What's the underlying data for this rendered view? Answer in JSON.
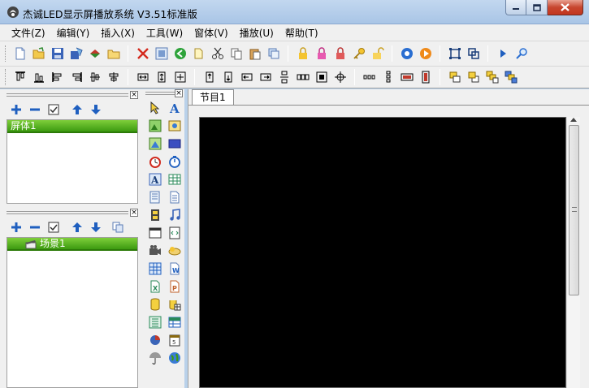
{
  "window": {
    "title": "杰诚LED显示屏播放系统 V3.51标准版"
  },
  "menu": [
    {
      "name": "menu-file",
      "label": "文件(Z)"
    },
    {
      "name": "menu-edit",
      "label": "编辑(Y)"
    },
    {
      "name": "menu-insert",
      "label": "插入(X)"
    },
    {
      "name": "menu-tools",
      "label": "工具(W)"
    },
    {
      "name": "menu-window",
      "label": "窗体(V)"
    },
    {
      "name": "menu-play",
      "label": "播放(U)"
    },
    {
      "name": "menu-help",
      "label": "帮助(T)"
    }
  ],
  "screen_panel": {
    "items": [
      {
        "label": "屏体1"
      }
    ]
  },
  "scene_panel": {
    "items": [
      {
        "label": "场景1"
      }
    ]
  },
  "main": {
    "tabs": [
      {
        "label": "节目1"
      }
    ]
  },
  "colors": {
    "tree_selected": "#3c9a10",
    "canvas": "#000000",
    "titlebar": "#b9d1ea"
  }
}
